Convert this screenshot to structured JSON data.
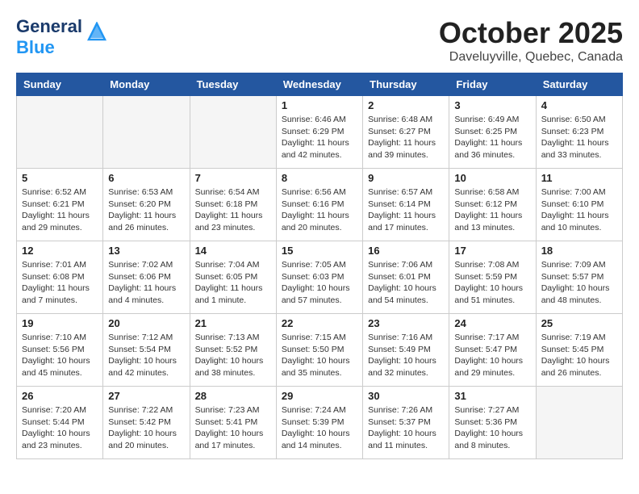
{
  "header": {
    "logo_general": "General",
    "logo_blue": "Blue",
    "month_title": "October 2025",
    "subtitle": "Daveluyville, Quebec, Canada"
  },
  "weekdays": [
    "Sunday",
    "Monday",
    "Tuesday",
    "Wednesday",
    "Thursday",
    "Friday",
    "Saturday"
  ],
  "weeks": [
    [
      {
        "day": "",
        "info": ""
      },
      {
        "day": "",
        "info": ""
      },
      {
        "day": "",
        "info": ""
      },
      {
        "day": "1",
        "info": "Sunrise: 6:46 AM\nSunset: 6:29 PM\nDaylight: 11 hours\nand 42 minutes."
      },
      {
        "day": "2",
        "info": "Sunrise: 6:48 AM\nSunset: 6:27 PM\nDaylight: 11 hours\nand 39 minutes."
      },
      {
        "day": "3",
        "info": "Sunrise: 6:49 AM\nSunset: 6:25 PM\nDaylight: 11 hours\nand 36 minutes."
      },
      {
        "day": "4",
        "info": "Sunrise: 6:50 AM\nSunset: 6:23 PM\nDaylight: 11 hours\nand 33 minutes."
      }
    ],
    [
      {
        "day": "5",
        "info": "Sunrise: 6:52 AM\nSunset: 6:21 PM\nDaylight: 11 hours\nand 29 minutes."
      },
      {
        "day": "6",
        "info": "Sunrise: 6:53 AM\nSunset: 6:20 PM\nDaylight: 11 hours\nand 26 minutes."
      },
      {
        "day": "7",
        "info": "Sunrise: 6:54 AM\nSunset: 6:18 PM\nDaylight: 11 hours\nand 23 minutes."
      },
      {
        "day": "8",
        "info": "Sunrise: 6:56 AM\nSunset: 6:16 PM\nDaylight: 11 hours\nand 20 minutes."
      },
      {
        "day": "9",
        "info": "Sunrise: 6:57 AM\nSunset: 6:14 PM\nDaylight: 11 hours\nand 17 minutes."
      },
      {
        "day": "10",
        "info": "Sunrise: 6:58 AM\nSunset: 6:12 PM\nDaylight: 11 hours\nand 13 minutes."
      },
      {
        "day": "11",
        "info": "Sunrise: 7:00 AM\nSunset: 6:10 PM\nDaylight: 11 hours\nand 10 minutes."
      }
    ],
    [
      {
        "day": "12",
        "info": "Sunrise: 7:01 AM\nSunset: 6:08 PM\nDaylight: 11 hours\nand 7 minutes."
      },
      {
        "day": "13",
        "info": "Sunrise: 7:02 AM\nSunset: 6:06 PM\nDaylight: 11 hours\nand 4 minutes."
      },
      {
        "day": "14",
        "info": "Sunrise: 7:04 AM\nSunset: 6:05 PM\nDaylight: 11 hours\nand 1 minute."
      },
      {
        "day": "15",
        "info": "Sunrise: 7:05 AM\nSunset: 6:03 PM\nDaylight: 10 hours\nand 57 minutes."
      },
      {
        "day": "16",
        "info": "Sunrise: 7:06 AM\nSunset: 6:01 PM\nDaylight: 10 hours\nand 54 minutes."
      },
      {
        "day": "17",
        "info": "Sunrise: 7:08 AM\nSunset: 5:59 PM\nDaylight: 10 hours\nand 51 minutes."
      },
      {
        "day": "18",
        "info": "Sunrise: 7:09 AM\nSunset: 5:57 PM\nDaylight: 10 hours\nand 48 minutes."
      }
    ],
    [
      {
        "day": "19",
        "info": "Sunrise: 7:10 AM\nSunset: 5:56 PM\nDaylight: 10 hours\nand 45 minutes."
      },
      {
        "day": "20",
        "info": "Sunrise: 7:12 AM\nSunset: 5:54 PM\nDaylight: 10 hours\nand 42 minutes."
      },
      {
        "day": "21",
        "info": "Sunrise: 7:13 AM\nSunset: 5:52 PM\nDaylight: 10 hours\nand 38 minutes."
      },
      {
        "day": "22",
        "info": "Sunrise: 7:15 AM\nSunset: 5:50 PM\nDaylight: 10 hours\nand 35 minutes."
      },
      {
        "day": "23",
        "info": "Sunrise: 7:16 AM\nSunset: 5:49 PM\nDaylight: 10 hours\nand 32 minutes."
      },
      {
        "day": "24",
        "info": "Sunrise: 7:17 AM\nSunset: 5:47 PM\nDaylight: 10 hours\nand 29 minutes."
      },
      {
        "day": "25",
        "info": "Sunrise: 7:19 AM\nSunset: 5:45 PM\nDaylight: 10 hours\nand 26 minutes."
      }
    ],
    [
      {
        "day": "26",
        "info": "Sunrise: 7:20 AM\nSunset: 5:44 PM\nDaylight: 10 hours\nand 23 minutes."
      },
      {
        "day": "27",
        "info": "Sunrise: 7:22 AM\nSunset: 5:42 PM\nDaylight: 10 hours\nand 20 minutes."
      },
      {
        "day": "28",
        "info": "Sunrise: 7:23 AM\nSunset: 5:41 PM\nDaylight: 10 hours\nand 17 minutes."
      },
      {
        "day": "29",
        "info": "Sunrise: 7:24 AM\nSunset: 5:39 PM\nDaylight: 10 hours\nand 14 minutes."
      },
      {
        "day": "30",
        "info": "Sunrise: 7:26 AM\nSunset: 5:37 PM\nDaylight: 10 hours\nand 11 minutes."
      },
      {
        "day": "31",
        "info": "Sunrise: 7:27 AM\nSunset: 5:36 PM\nDaylight: 10 hours\nand 8 minutes."
      },
      {
        "day": "",
        "info": ""
      }
    ]
  ]
}
